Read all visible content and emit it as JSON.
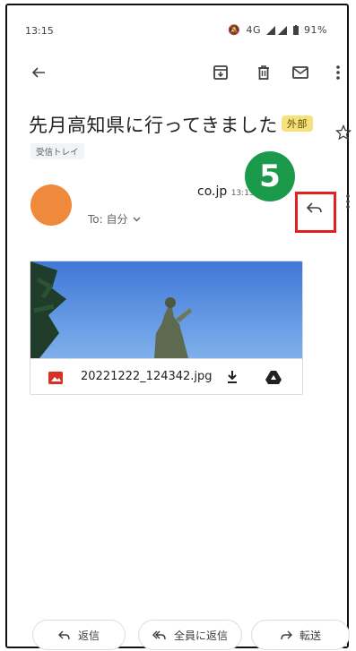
{
  "status": {
    "time": "13:15",
    "network": "4G",
    "battery": "91%"
  },
  "toolbar": {
    "back_icon": "arrow-left-icon",
    "archive_icon": "archive-icon",
    "delete_icon": "trash-icon",
    "mark_unread_icon": "mail-icon",
    "more_icon": "more-vertical-icon"
  },
  "email": {
    "subject": "先月高知県に行ってきました",
    "external_label": "外部",
    "inbox_chip": "受信トレイ",
    "sender_domain": "co.jp",
    "sender_time": "13:13",
    "to_label": "To: 自分",
    "avatar_color": "#ef8a3c"
  },
  "step_marker": "5",
  "attachment": {
    "file_name": "20221222_124342.jpg"
  },
  "actions": {
    "reply": "返信",
    "reply_all": "全員に返信",
    "forward": "転送"
  },
  "colors": {
    "step_green": "#1c9a4c",
    "highlight_red": "#e32020"
  }
}
